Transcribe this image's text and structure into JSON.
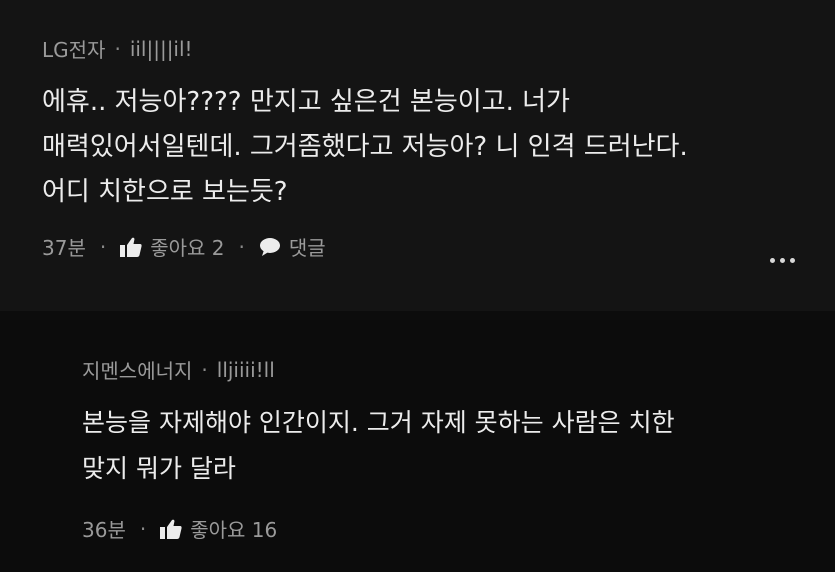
{
  "comments": [
    {
      "author": "LG전자",
      "handle": "iil||||il!",
      "body": "에휴.. 저능아???? 만지고 싶은건 본능이고. 너가\n매력있어서일텐데. 그거좀했다고 저능아? 니 인격 드러난다.\n어디 치한으로 보는듯?",
      "time": "37분",
      "likes_label": "좋아요 2",
      "reply_label": "댓글"
    },
    {
      "author": "지멘스에너지",
      "handle": "lljiiii!ll",
      "body": "본능을 자제해야 인간이지. 그거 자제 못하는 사람은 치한\n맞지 뭐가 달라",
      "time": "36분",
      "likes_label": "좋아요 16"
    }
  ],
  "separator": "·",
  "icons": {
    "like": "thumbs-up-icon",
    "reply": "speech-bubble-icon",
    "more": "more-dots-icon"
  },
  "colors": {
    "background": "#0e0e0e",
    "text": "#ececec",
    "meta": "#9a9a9a"
  }
}
